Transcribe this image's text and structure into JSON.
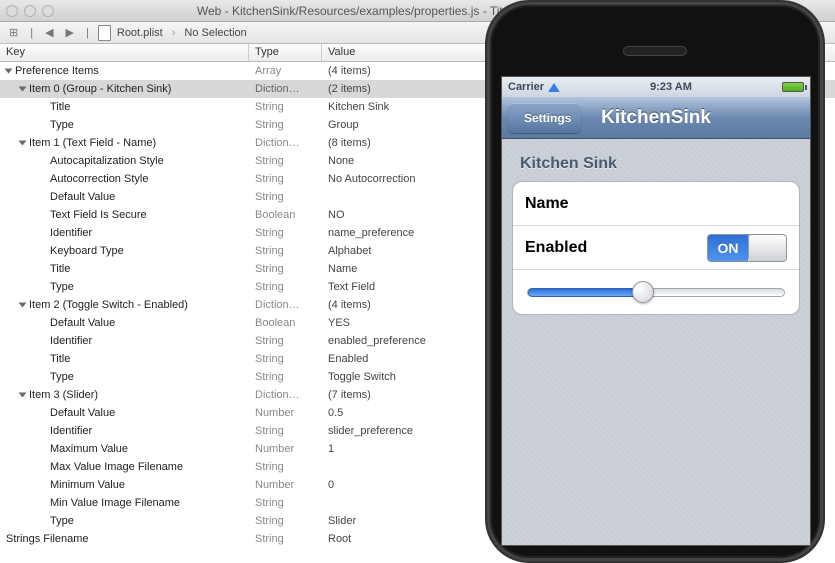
{
  "window": {
    "title": "Web - KitchenSink/Resources/examples/properties.js - Titanium Studio - ...ts/tpouls"
  },
  "breadcrumb": {
    "file": "Root.plist",
    "selection": "No Selection"
  },
  "columns": {
    "key": "Key",
    "type": "Type",
    "value": "Value"
  },
  "rows": [
    {
      "indent": 6,
      "tri": true,
      "key": "Preference Items",
      "type": "Array",
      "value": "(4 items)",
      "sel": false
    },
    {
      "indent": 20,
      "tri": true,
      "key": "Item 0 (Group - Kitchen Sink)",
      "type": "Diction…",
      "value": "(2 items)",
      "sel": true
    },
    {
      "indent": 50,
      "tri": false,
      "key": "Title",
      "type": "String",
      "value": "Kitchen Sink"
    },
    {
      "indent": 50,
      "tri": false,
      "key": "Type",
      "type": "String",
      "value": "Group"
    },
    {
      "indent": 20,
      "tri": true,
      "key": "Item 1 (Text Field - Name)",
      "type": "Diction…",
      "value": "(8 items)"
    },
    {
      "indent": 50,
      "tri": false,
      "key": "Autocapitalization Style",
      "type": "String",
      "value": "None"
    },
    {
      "indent": 50,
      "tri": false,
      "key": "Autocorrection Style",
      "type": "String",
      "value": "No Autocorrection"
    },
    {
      "indent": 50,
      "tri": false,
      "key": "Default Value",
      "type": "String",
      "value": ""
    },
    {
      "indent": 50,
      "tri": false,
      "key": "Text Field Is Secure",
      "type": "Boolean",
      "value": "NO"
    },
    {
      "indent": 50,
      "tri": false,
      "key": "Identifier",
      "type": "String",
      "value": "name_preference"
    },
    {
      "indent": 50,
      "tri": false,
      "key": "Keyboard Type",
      "type": "String",
      "value": "Alphabet"
    },
    {
      "indent": 50,
      "tri": false,
      "key": "Title",
      "type": "String",
      "value": "Name"
    },
    {
      "indent": 50,
      "tri": false,
      "key": "Type",
      "type": "String",
      "value": "Text Field"
    },
    {
      "indent": 20,
      "tri": true,
      "key": "Item 2 (Toggle Switch - Enabled)",
      "type": "Diction…",
      "value": "(4 items)"
    },
    {
      "indent": 50,
      "tri": false,
      "key": "Default Value",
      "type": "Boolean",
      "value": "YES"
    },
    {
      "indent": 50,
      "tri": false,
      "key": "Identifier",
      "type": "String",
      "value": "enabled_preference"
    },
    {
      "indent": 50,
      "tri": false,
      "key": "Title",
      "type": "String",
      "value": "Enabled"
    },
    {
      "indent": 50,
      "tri": false,
      "key": "Type",
      "type": "String",
      "value": "Toggle Switch"
    },
    {
      "indent": 20,
      "tri": true,
      "key": "Item 3 (Slider)",
      "type": "Diction…",
      "value": "(7 items)"
    },
    {
      "indent": 50,
      "tri": false,
      "key": "Default Value",
      "type": "Number",
      "value": "0.5"
    },
    {
      "indent": 50,
      "tri": false,
      "key": "Identifier",
      "type": "String",
      "value": "slider_preference"
    },
    {
      "indent": 50,
      "tri": false,
      "key": "Maximum Value",
      "type": "Number",
      "value": "1"
    },
    {
      "indent": 50,
      "tri": false,
      "key": "Max Value Image Filename",
      "type": "String",
      "value": ""
    },
    {
      "indent": 50,
      "tri": false,
      "key": "Minimum Value",
      "type": "Number",
      "value": "0"
    },
    {
      "indent": 50,
      "tri": false,
      "key": "Min Value Image Filename",
      "type": "String",
      "value": ""
    },
    {
      "indent": 50,
      "tri": false,
      "key": "Type",
      "type": "String",
      "value": "Slider"
    },
    {
      "indent": 6,
      "tri": false,
      "key": "Strings Filename",
      "type": "String",
      "value": "Root"
    }
  ],
  "sim": {
    "carrier": "Carrier",
    "time": "9:23 AM",
    "back": "Settings",
    "navtitle": "KitchenSink",
    "group": "Kitchen Sink",
    "name_label": "Name",
    "enabled_label": "Enabled",
    "toggle_on": "ON",
    "slider_value": 0.45
  }
}
